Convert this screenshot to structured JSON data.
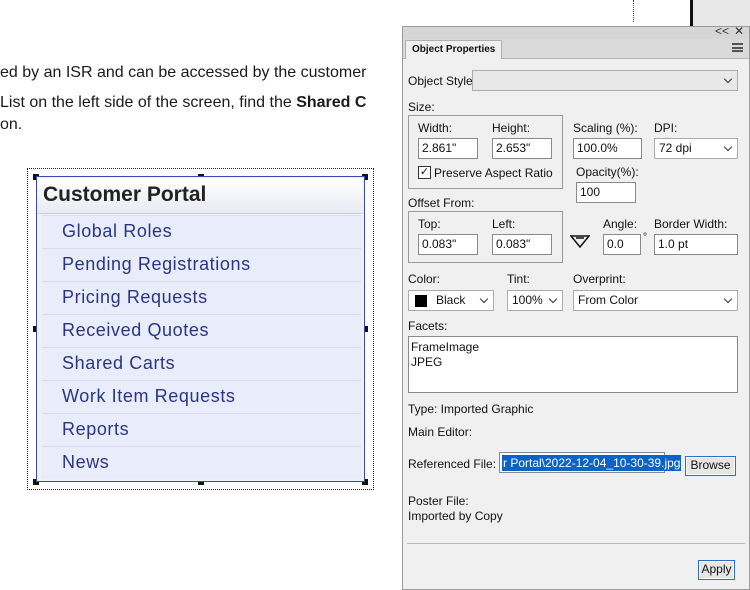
{
  "document": {
    "line1": "ed by an ISR and can be accessed by the customer",
    "line2_text": " List on the left side of the screen, find the ",
    "line2_bold": "Shared C",
    "line3": "on."
  },
  "portal": {
    "title": "Customer Portal",
    "items": [
      "Global Roles",
      "Pending Registrations",
      "Pricing Requests",
      "Received Quotes",
      "Shared Carts",
      "Work Item Requests",
      "Reports",
      "News"
    ]
  },
  "panel": {
    "tab_label": "Object Properties",
    "collapse_label": "<<",
    "close_label": "✕",
    "object_style_label": "Object Style:",
    "object_style_value": "",
    "size_label": "Size:",
    "width_label": "Width:",
    "width_value": "2.861\"",
    "height_label": "Height:",
    "height_value": "2.653\"",
    "preserve_label": "Preserve Aspect Ratio",
    "preserve_checked": "✓",
    "scaling_label": "Scaling (%):",
    "scaling_value": "100.0%",
    "dpi_label": "DPI:",
    "dpi_value": "72 dpi",
    "opacity_label": "Opacity(%):",
    "opacity_value": "100",
    "offset_label": "Offset From:",
    "top_label": "Top:",
    "top_value": "0.083\"",
    "left_label": "Left:",
    "left_value": "0.083\"",
    "angle_label": "Angle:",
    "angle_value": "0.0",
    "degree_symbol": "°",
    "border_label": "Border Width:",
    "border_value": "1.0 pt",
    "color_label": "Color:",
    "color_value": "Black",
    "tint_label": "Tint:",
    "tint_value": "100%",
    "overprint_label": "Overprint:",
    "overprint_value": "From Color",
    "facets_label": "Facets:",
    "facets": [
      "FrameImage",
      "JPEG"
    ],
    "type_text": "Type: Imported Graphic",
    "main_editor_text": "Main Editor:",
    "ref_label": "Referenced File:",
    "ref_value": "r Portal\\2022-12-04_10-30-39.jpg",
    "browse_label": "Browse",
    "poster_label": "Poster File:",
    "poster_value": "Imported by Copy",
    "apply_label": "Apply"
  },
  "colors": {
    "selection_blue": "#0a64c8",
    "portal_text": "#2a3585",
    "swatch_black": "#000000"
  }
}
